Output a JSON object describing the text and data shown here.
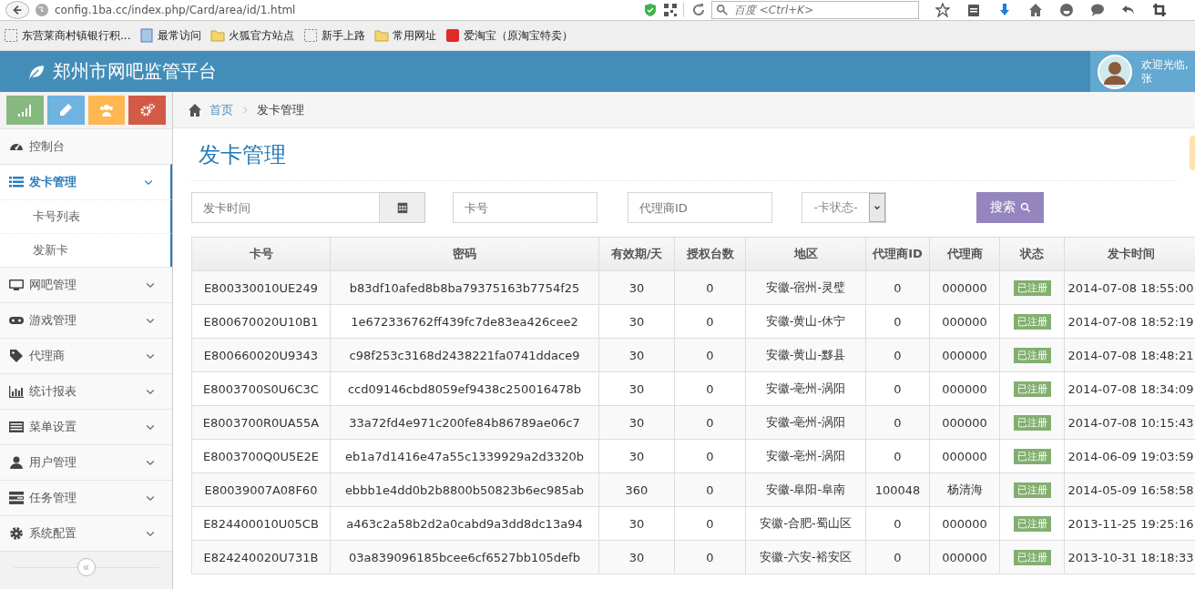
{
  "browser": {
    "url": "config.1ba.cc/index.php/Card/area/id/1.html",
    "search_placeholder": "百度 <Ctrl+K>",
    "bookmarks": [
      {
        "label": "东营莱商村镇银行积..."
      },
      {
        "label": "最常访问"
      },
      {
        "label": "火狐官方站点"
      },
      {
        "label": "新手上路"
      },
      {
        "label": "常用网址"
      },
      {
        "label": "爱淘宝（原淘宝特卖）"
      }
    ]
  },
  "header": {
    "title": "郑州市网吧监管平台",
    "welcome": "欢迎光临,",
    "user": "张"
  },
  "shortcuts": [
    {
      "color": "#87b87f"
    },
    {
      "color": "#6fb3e0"
    },
    {
      "color": "#ffb752"
    },
    {
      "color": "#d15b47"
    }
  ],
  "sidebar": {
    "items": [
      {
        "label": "控制台",
        "selected": false
      },
      {
        "label": "发卡管理",
        "selected": true,
        "expanded": true,
        "children": [
          {
            "label": "卡号列表",
            "selected": false
          },
          {
            "label": "发新卡",
            "selected": false
          }
        ]
      },
      {
        "label": "网吧管理",
        "selected": false
      },
      {
        "label": "游戏管理",
        "selected": false
      },
      {
        "label": "代理商",
        "selected": false
      },
      {
        "label": "统计报表",
        "selected": false
      },
      {
        "label": "菜单设置",
        "selected": false
      },
      {
        "label": "用户管理",
        "selected": false
      },
      {
        "label": "任务管理",
        "selected": false
      },
      {
        "label": "系统配置",
        "selected": false
      }
    ],
    "collapse": "«"
  },
  "breadcrumb": [
    {
      "label": "首页"
    },
    {
      "label": "发卡管理"
    }
  ],
  "page_title": "发卡管理",
  "filters": {
    "date_placeholder": "发卡时间",
    "card_placeholder": "卡号",
    "agent_placeholder": "代理商ID",
    "status_value": "-卡状态-",
    "search_button": "搜索"
  },
  "table": {
    "columns": [
      "卡号",
      "密码",
      "有效期/天",
      "授权台数",
      "地区",
      "代理商ID",
      "代理商",
      "状态",
      "发卡时间"
    ],
    "rows": [
      [
        "E800330010UE249",
        "b83df10afed8b8ba79375163b7754f25",
        "30",
        "0",
        "安徽-宿州-灵璧",
        "0",
        "000000",
        "已注册",
        "2014-07-08 18:55:00"
      ],
      [
        "E800670020U10B1",
        "1e672336762ff439fc7de83ea426cee2",
        "30",
        "0",
        "安徽-黄山-休宁",
        "0",
        "000000",
        "已注册",
        "2014-07-08 18:52:19"
      ],
      [
        "E800660020U9343",
        "c98f253c3168d2438221fa0741ddace9",
        "30",
        "0",
        "安徽-黄山-黟县",
        "0",
        "000000",
        "已注册",
        "2014-07-08 18:48:21"
      ],
      [
        "E8003700S0U6C3C",
        "ccd09146cbd8059ef9438c250016478b",
        "30",
        "0",
        "安徽-亳州-涡阳",
        "0",
        "000000",
        "已注册",
        "2014-07-08 18:34:09"
      ],
      [
        "E8003700R0UA55A",
        "33a72fd4e971c200fe84b86789ae06c7",
        "30",
        "0",
        "安徽-亳州-涡阳",
        "0",
        "000000",
        "已注册",
        "2014-07-08 10:15:43"
      ],
      [
        "E8003700Q0U5E2E",
        "eb1a7d1416e47a55c1339929a2d3320b",
        "30",
        "0",
        "安徽-亳州-涡阳",
        "0",
        "000000",
        "已注册",
        "2014-06-09 19:03:59"
      ],
      [
        "E80039007A08F60",
        "ebbb1e4dd0b2b8800b50823b6ec985ab",
        "360",
        "0",
        "安徽-阜阳-阜南",
        "100048",
        "杨清海",
        "已注册",
        "2014-05-09 16:58:58"
      ],
      [
        "E824400010U05CB",
        "a463c2a58b2d2a0cabd9a3dd8dc13a94",
        "30",
        "0",
        "安徽-合肥-蜀山区",
        "0",
        "000000",
        "已注册",
        "2013-11-25 19:25:16"
      ],
      [
        "E824240020U731B",
        "03a839096185bcee6cf6527bb105defb",
        "30",
        "0",
        "安徽-六安-裕安区",
        "0",
        "000000",
        "已注册",
        "2013-10-31 18:18:33"
      ]
    ]
  }
}
